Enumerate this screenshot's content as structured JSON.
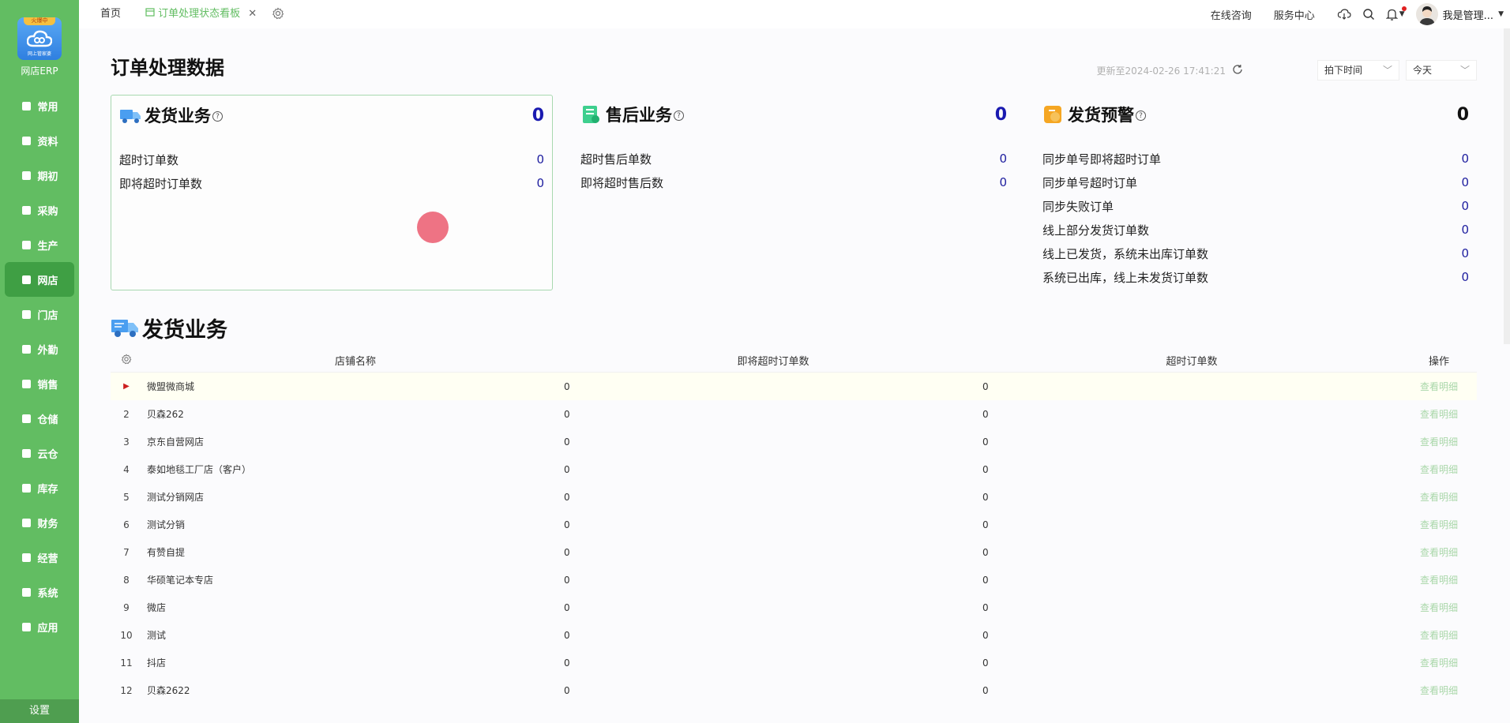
{
  "sidebar": {
    "logo_ribbon": "火爆中",
    "logo_sub": "网上管家婆",
    "logo_text": "网店ERP",
    "items": [
      {
        "label": "常用",
        "icon": "star-icon"
      },
      {
        "label": "资料",
        "icon": "document-icon"
      },
      {
        "label": "期初",
        "icon": "clock-icon"
      },
      {
        "label": "采购",
        "icon": "cart-icon"
      },
      {
        "label": "生产",
        "icon": "factory-icon"
      },
      {
        "label": "网店",
        "icon": "shop-icon"
      },
      {
        "label": "门店",
        "icon": "store-icon"
      },
      {
        "label": "外勤",
        "icon": "location-icon"
      },
      {
        "label": "销售",
        "icon": "chart-icon"
      },
      {
        "label": "仓储",
        "icon": "warehouse-icon"
      },
      {
        "label": "云仓",
        "icon": "cloud-icon"
      },
      {
        "label": "库存",
        "icon": "box-icon"
      },
      {
        "label": "财务",
        "icon": "money-icon"
      },
      {
        "label": "经营",
        "icon": "report-icon"
      },
      {
        "label": "系统",
        "icon": "gear-icon"
      },
      {
        "label": "应用",
        "icon": "plus-icon"
      }
    ],
    "active_index": 5,
    "settings_label": "设置"
  },
  "topbar": {
    "tabs": [
      {
        "label": "首页"
      },
      {
        "label": "订单处理状态看板"
      }
    ],
    "links": [
      "在线咨询",
      "服务中心"
    ],
    "user_name": "我是管理..."
  },
  "header": {
    "title": "订单处理数据",
    "updated": "更新至2024-02-26 17:41:21",
    "time_type": "拍下时间",
    "time_range": "今天"
  },
  "cards": [
    {
      "title": "发货业务",
      "count": "0",
      "count_color": "#1a1ab0",
      "rows": [
        {
          "label": "超时订单数",
          "value": "0"
        },
        {
          "label": "即将超时订单数",
          "value": "0"
        }
      ]
    },
    {
      "title": "售后业务",
      "count": "0",
      "count_color": "#1a1ab0",
      "rows": [
        {
          "label": "超时售后单数",
          "value": "0"
        },
        {
          "label": "即将超时售后数",
          "value": "0"
        }
      ]
    },
    {
      "title": "发货预警",
      "count": "0",
      "count_color": "#111111",
      "rows": [
        {
          "label": "同步单号即将超时订单",
          "value": "0"
        },
        {
          "label": "同步单号超时订单",
          "value": "0"
        },
        {
          "label": "同步失败订单",
          "value": "0"
        },
        {
          "label": "线上部分发货订单数",
          "value": "0"
        },
        {
          "label": "线上已发货，系统未出库订单数",
          "value": "0"
        },
        {
          "label": "系统已出库，线上未发货订单数",
          "value": "0"
        }
      ]
    }
  ],
  "section": {
    "title": "发货业务"
  },
  "table": {
    "headers": [
      "店铺名称",
      "即将超时订单数",
      "超时订单数",
      "操作"
    ],
    "action_label": "查看明细",
    "rows": [
      {
        "no": "▶",
        "name": "微盟微商城",
        "soon": "0",
        "over": "0"
      },
      {
        "no": "2",
        "name": "贝森262",
        "soon": "0",
        "over": "0"
      },
      {
        "no": "3",
        "name": "京东自营网店",
        "soon": "0",
        "over": "0"
      },
      {
        "no": "4",
        "name": "泰如地毯工厂店（客户）",
        "soon": "0",
        "over": "0"
      },
      {
        "no": "5",
        "name": "测试分销网店",
        "soon": "0",
        "over": "0"
      },
      {
        "no": "6",
        "name": "测试分销",
        "soon": "0",
        "over": "0"
      },
      {
        "no": "7",
        "name": "有赞自提",
        "soon": "0",
        "over": "0"
      },
      {
        "no": "8",
        "name": "华硕笔记本专店",
        "soon": "0",
        "over": "0"
      },
      {
        "no": "9",
        "name": "微店",
        "soon": "0",
        "over": "0"
      },
      {
        "no": "10",
        "name": "测试",
        "soon": "0",
        "over": "0"
      },
      {
        "no": "11",
        "name": "抖店",
        "soon": "0",
        "over": "0"
      },
      {
        "no": "12",
        "name": "贝森2622",
        "soon": "0",
        "over": "0"
      }
    ]
  },
  "colors": {
    "sidebar": "#62bd62",
    "accent": "#62bd62",
    "count_blue": "#1a1ab0",
    "link": "#a9d7a9"
  }
}
